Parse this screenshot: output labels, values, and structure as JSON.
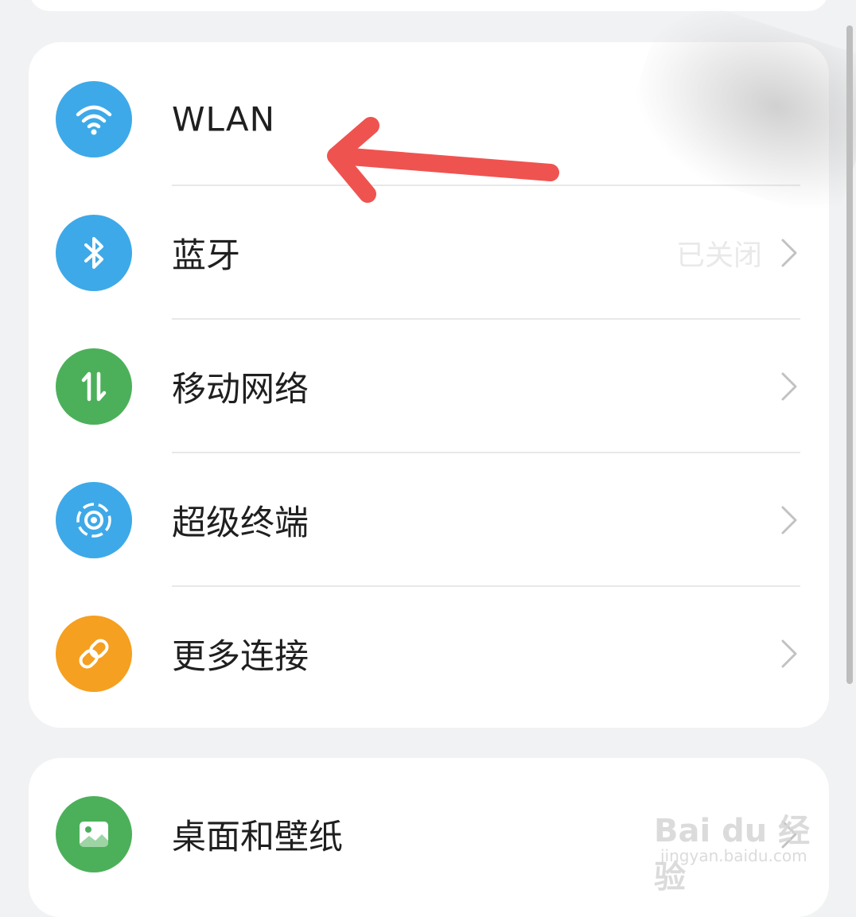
{
  "connectivity_group": {
    "items": [
      {
        "label": "WLAN",
        "icon": "wifi-icon",
        "color": "#3ea9e8",
        "status": "",
        "chevron": false
      },
      {
        "label": "蓝牙",
        "icon": "bluetooth-icon",
        "color": "#3ea9e8",
        "status": "已关闭",
        "chevron": true
      },
      {
        "label": "移动网络",
        "icon": "mobile-data-icon",
        "color": "#4cb05a",
        "status": "",
        "chevron": true
      },
      {
        "label": "超级终端",
        "icon": "super-device-icon",
        "color": "#3ea9e8",
        "status": "",
        "chevron": true
      },
      {
        "label": "更多连接",
        "icon": "link-icon",
        "color": "#f5a020",
        "status": "",
        "chevron": true
      }
    ]
  },
  "display_group": {
    "items": [
      {
        "label": "桌面和壁纸",
        "icon": "wallpaper-icon",
        "color": "#4cb05a",
        "chevron": true
      }
    ]
  },
  "annotation": {
    "arrow_color": "#ef5350",
    "points_to": "WLAN"
  },
  "watermark": {
    "main": "Bai du 经验",
    "sub": "jingyan.baidu.com"
  }
}
